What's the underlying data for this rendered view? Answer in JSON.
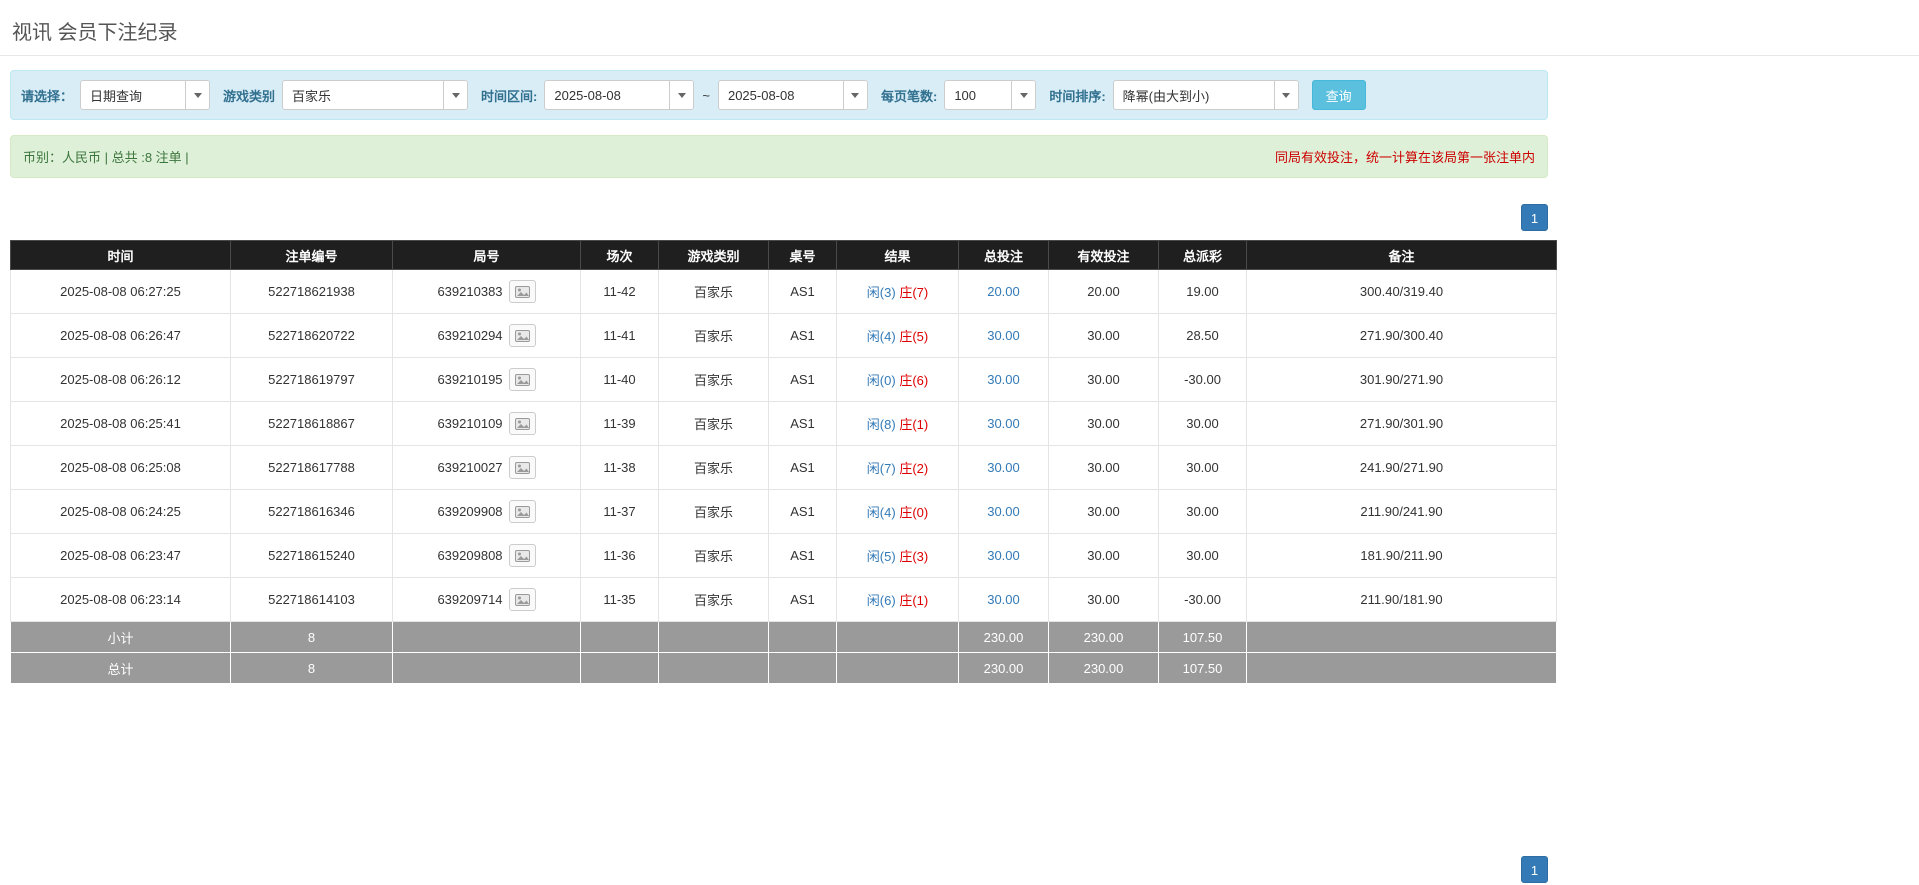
{
  "page": {
    "title": "视讯 会员下注纪录"
  },
  "colors": {
    "accent_blue": "#337ab7",
    "filter_bar_bg": "#d9edf7",
    "filter_label_blue": "#31708f",
    "search_btn_bg": "#5bc0de",
    "info_bar_bg": "#dff0d8",
    "info_text_green": "#3c763d",
    "warning_text_red": "#cc0000",
    "result_player_blue": "#337ab7",
    "result_banker_red": "#dd0000",
    "negative_red": "#dd0000",
    "header_bg": "#1f1f1f",
    "footer_row_bg": "#9a9a9a"
  },
  "filters": {
    "select_label": "请选择：",
    "select_value": "日期查询",
    "game_type_label": "游戏类别",
    "game_type_value": "百家乐",
    "date_range_label": "时间区间:",
    "date_from": "2025-08-08",
    "date_tilde": "~",
    "date_to": "2025-08-08",
    "page_size_label": "每页笔数:",
    "page_size_value": "100",
    "sort_label": "时间排序:",
    "sort_value": "降幂(由大到小)",
    "search_button": "查询"
  },
  "summary": {
    "left": "币别：人民币 | 总共 :8 注单 |",
    "right": "同局有效投注，统一计算在该局第一张注单内"
  },
  "pagination": {
    "page": "1"
  },
  "table": {
    "headers": [
      "时间",
      "注单编号",
      "局号",
      "场次",
      "游戏类别",
      "桌号",
      "结果",
      "总投注",
      "有效投注",
      "总派彩",
      "备注"
    ],
    "rows": [
      {
        "time": "2025-08-08 06:27:25",
        "bet_no": "522718621938",
        "round_no": "639210383",
        "session": "11-42",
        "game": "百家乐",
        "table": "AS1",
        "result_player": "闲(3)",
        "result_banker": "庄(7)",
        "total_bet": "20.00",
        "valid_bet": "20.00",
        "payout": "19.00",
        "note": "300.40/319.40"
      },
      {
        "time": "2025-08-08 06:26:47",
        "bet_no": "522718620722",
        "round_no": "639210294",
        "session": "11-41",
        "game": "百家乐",
        "table": "AS1",
        "result_player": "闲(4)",
        "result_banker": "庄(5)",
        "total_bet": "30.00",
        "valid_bet": "30.00",
        "payout": "28.50",
        "note": "271.90/300.40"
      },
      {
        "time": "2025-08-08 06:26:12",
        "bet_no": "522718619797",
        "round_no": "639210195",
        "session": "11-40",
        "game": "百家乐",
        "table": "AS1",
        "result_player": "闲(0)",
        "result_banker": "庄(6)",
        "total_bet": "30.00",
        "valid_bet": "30.00",
        "payout": "-30.00",
        "note": "301.90/271.90"
      },
      {
        "time": "2025-08-08 06:25:41",
        "bet_no": "522718618867",
        "round_no": "639210109",
        "session": "11-39",
        "game": "百家乐",
        "table": "AS1",
        "result_player": "闲(8)",
        "result_banker": "庄(1)",
        "total_bet": "30.00",
        "valid_bet": "30.00",
        "payout": "30.00",
        "note": "271.90/301.90"
      },
      {
        "time": "2025-08-08 06:25:08",
        "bet_no": "522718617788",
        "round_no": "639210027",
        "session": "11-38",
        "game": "百家乐",
        "table": "AS1",
        "result_player": "闲(7)",
        "result_banker": "庄(2)",
        "total_bet": "30.00",
        "valid_bet": "30.00",
        "payout": "30.00",
        "note": "241.90/271.90"
      },
      {
        "time": "2025-08-08 06:24:25",
        "bet_no": "522718616346",
        "round_no": "639209908",
        "session": "11-37",
        "game": "百家乐",
        "table": "AS1",
        "result_player": "闲(4)",
        "result_banker": "庄(0)",
        "total_bet": "30.00",
        "valid_bet": "30.00",
        "payout": "30.00",
        "note": "211.90/241.90"
      },
      {
        "time": "2025-08-08 06:23:47",
        "bet_no": "522718615240",
        "round_no": "639209808",
        "session": "11-36",
        "game": "百家乐",
        "table": "AS1",
        "result_player": "闲(5)",
        "result_banker": "庄(3)",
        "total_bet": "30.00",
        "valid_bet": "30.00",
        "payout": "30.00",
        "note": "181.90/211.90"
      },
      {
        "time": "2025-08-08 06:23:14",
        "bet_no": "522718614103",
        "round_no": "639209714",
        "session": "11-35",
        "game": "百家乐",
        "table": "AS1",
        "result_player": "闲(6)",
        "result_banker": "庄(1)",
        "total_bet": "30.00",
        "valid_bet": "30.00",
        "payout": "-30.00",
        "note": "211.90/181.90"
      }
    ],
    "subtotal": {
      "label": "小计",
      "count": "8",
      "total_bet": "230.00",
      "valid_bet": "230.00",
      "payout": "107.50"
    },
    "total": {
      "label": "总计",
      "count": "8",
      "total_bet": "230.00",
      "valid_bet": "230.00",
      "payout": "107.50"
    }
  }
}
